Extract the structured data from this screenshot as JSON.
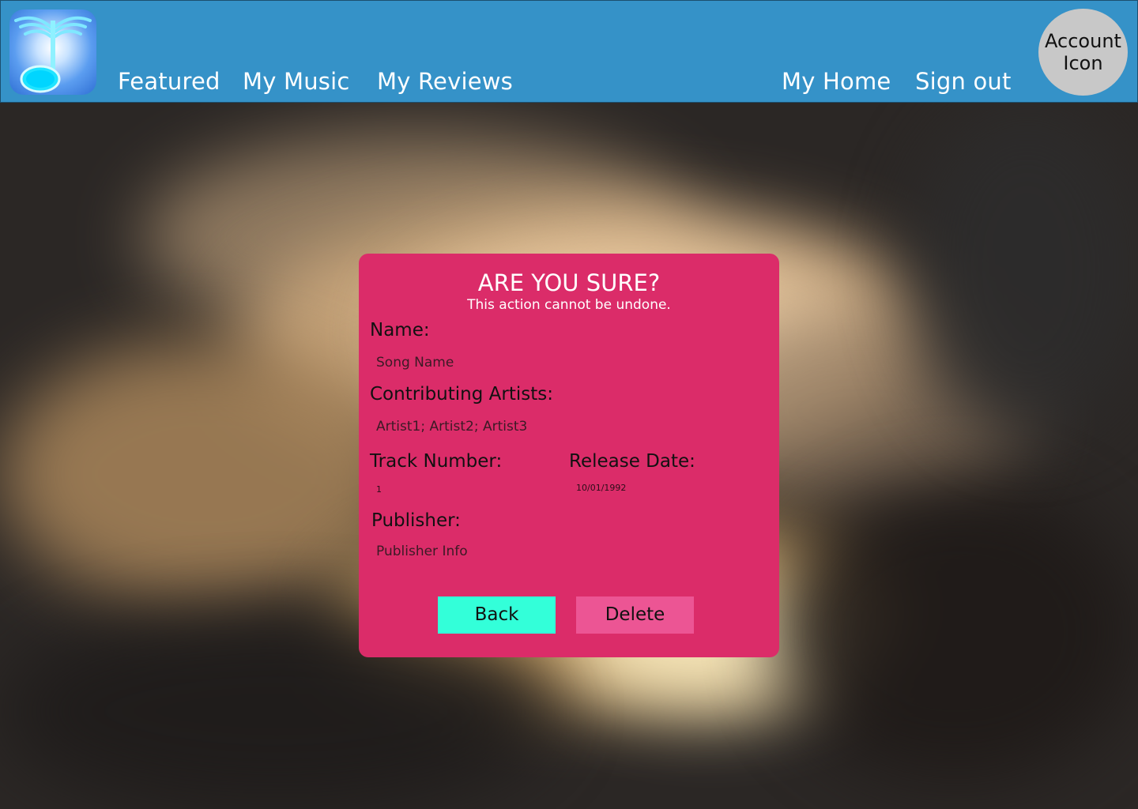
{
  "header": {
    "nav_left": [
      "Featured",
      "My Music",
      "My Reviews"
    ],
    "nav_right": [
      "My Home",
      "Sign out"
    ],
    "account_label": "Account Icon",
    "colors": {
      "bar": "#3592c8",
      "account": "#c8c8c8"
    }
  },
  "logo": {
    "icon": "winged-music-note-icon"
  },
  "dialog": {
    "title": "ARE YOU SURE?",
    "subtitle": "This action cannot be undone.",
    "fields": {
      "name_label": "Name:",
      "name_value": "Song Name",
      "artists_label": "Contributing Artists:",
      "artists_value": "Artist1; Artist2; Artist3",
      "track_label": "Track Number:",
      "track_value": "1",
      "release_label": "Release Date:",
      "release_value": "10/01/1992",
      "publisher_label": "Publisher:",
      "publisher_value": "Publisher Info"
    },
    "buttons": {
      "back": "Back",
      "delete": "Delete"
    },
    "colors": {
      "panel": "#db2c69",
      "back": "#33ffd9",
      "delete": "#ec5594"
    }
  }
}
